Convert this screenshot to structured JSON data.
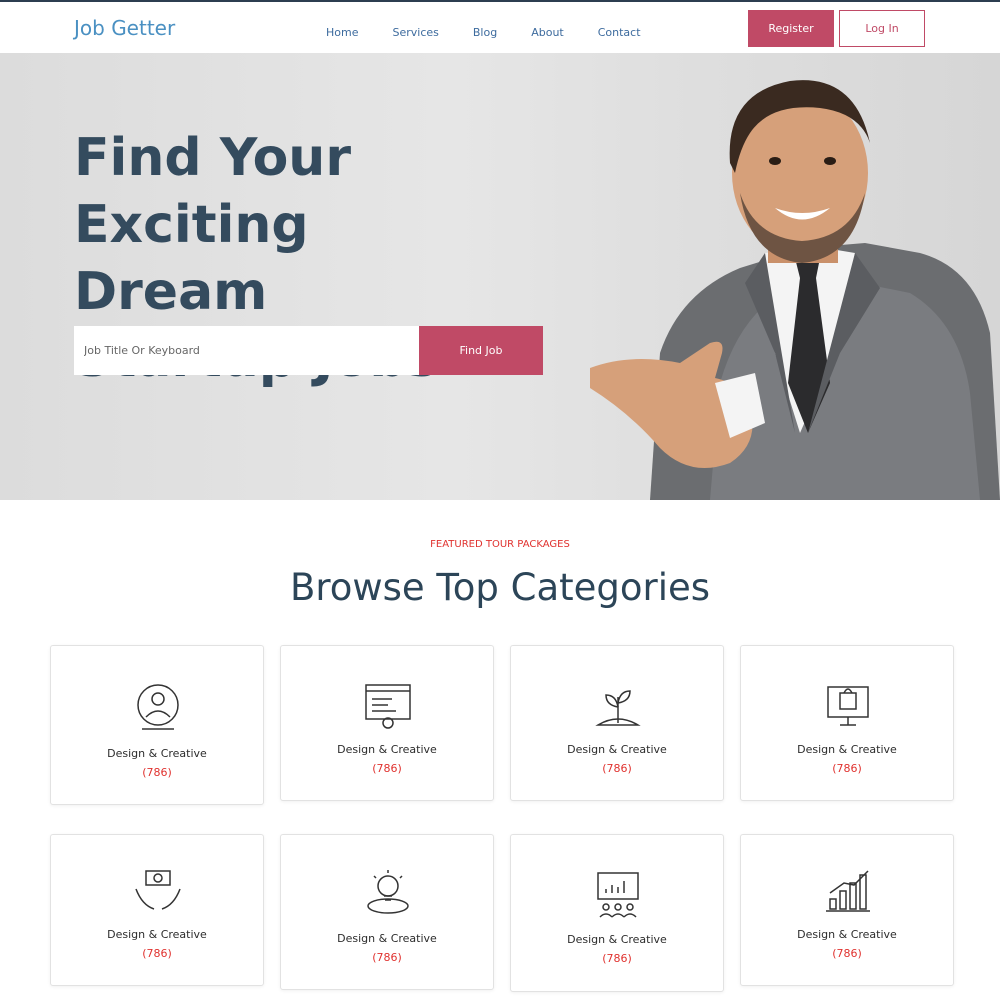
{
  "header": {
    "logo": "Job Getter",
    "nav": [
      "Home",
      "Services",
      "Blog",
      "About",
      "Contact"
    ],
    "register_label": "Register",
    "login_label": "Log In"
  },
  "hero": {
    "title_lines": [
      "Find Your Exciting",
      "Dream",
      "Startup Jobs"
    ],
    "search_placeholder": "Job Title Or Keyboard",
    "find_label": "Find Job"
  },
  "categories": {
    "eyebrow": "FEATURED TOUR PACKAGES",
    "title": "Browse Top Categories",
    "items": [
      {
        "label": "Design & Creative",
        "count": "(786)",
        "icon": "user-monitor-icon"
      },
      {
        "label": "Design & Creative",
        "count": "(786)",
        "icon": "code-window-gear-icon"
      },
      {
        "label": "Design & Creative",
        "count": "(786)",
        "icon": "plant-growth-icon"
      },
      {
        "label": "Design & Creative",
        "count": "(786)",
        "icon": "shopping-monitor-icon"
      },
      {
        "label": "Design & Creative",
        "count": "(786)",
        "icon": "money-hands-icon"
      },
      {
        "label": "Design & Creative",
        "count": "(786)",
        "icon": "idea-bulb-icon"
      },
      {
        "label": "Design & Creative",
        "count": "(786)",
        "icon": "presentation-icon"
      },
      {
        "label": "Design & Creative",
        "count": "(786)",
        "icon": "bar-chart-growth-icon"
      }
    ]
  },
  "colors": {
    "accent": "#c04a66",
    "logo": "#4a90c2",
    "nav": "#3d6b9e",
    "heading": "#344b5e",
    "count": "#e0322f"
  }
}
